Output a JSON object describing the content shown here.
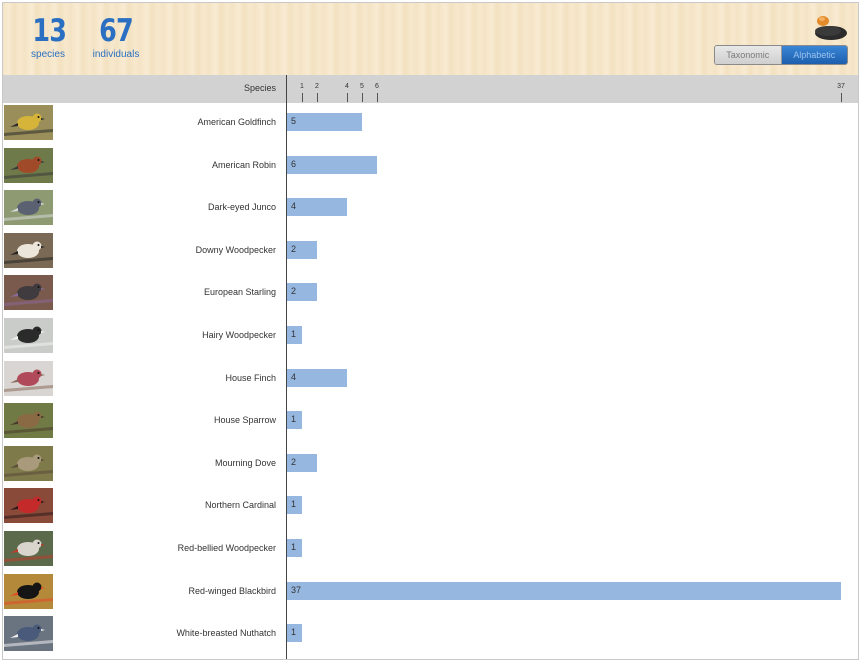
{
  "summary": {
    "species_count": "13",
    "species_label": "species",
    "individuals_count": "67",
    "individuals_label": "individuals"
  },
  "sort_toggle": {
    "taxonomic": "Taxonomic",
    "alphabetic": "Alphabetic",
    "selected": "Alphabetic"
  },
  "table": {
    "species_header": "Species"
  },
  "colors": {
    "bar": "#96b7e0",
    "accent": "#2a6fc1",
    "toggle_active": "#1d5fae"
  },
  "chart_data": {
    "type": "bar",
    "orientation": "horizontal",
    "xlim": [
      0,
      37
    ],
    "ticks": [
      "1",
      "2",
      "4",
      "5",
      "6",
      "37"
    ],
    "categories": [
      "American Goldfinch",
      "American Robin",
      "Dark-eyed Junco",
      "Downy Woodpecker",
      "European Starling",
      "Hairy Woodpecker",
      "House Finch",
      "House Sparrow",
      "Mourning Dove",
      "Northern Cardinal",
      "Red-bellied Woodpecker",
      "Red-winged Blackbird",
      "White-breasted Nuthatch"
    ],
    "values": [
      5,
      6,
      4,
      2,
      2,
      1,
      4,
      1,
      2,
      1,
      1,
      37,
      1
    ]
  },
  "thumbs": [
    {
      "bg": "#9a8f5a",
      "bird": "#d6b43a",
      "accent": "#2b2b2b"
    },
    {
      "bg": "#6f7a4a",
      "bird": "#a14a2a",
      "accent": "#3a3a3a"
    },
    {
      "bg": "#8d9a72",
      "bird": "#5a6170",
      "accent": "#d9d9d9"
    },
    {
      "bg": "#7a6a55",
      "bird": "#ece6da",
      "accent": "#222222"
    },
    {
      "bg": "#7b5a4e",
      "bird": "#3f3b3e",
      "accent": "#8a6a9a"
    },
    {
      "bg": "#c9ccc8",
      "bird": "#2b2b2b",
      "accent": "#f2f2f2"
    },
    {
      "bg": "#d8d5d2",
      "bird": "#b04a5a",
      "accent": "#8a6a5a"
    },
    {
      "bg": "#6f7a45",
      "bird": "#8a6a45",
      "accent": "#4a3a2a"
    },
    {
      "bg": "#7f7a4a",
      "bird": "#a89a7a",
      "accent": "#5a4a3a"
    },
    {
      "bg": "#8a4a3a",
      "bird": "#c42a2a",
      "accent": "#2a1a1a"
    },
    {
      "bg": "#5a6a4a",
      "bird": "#d9d4cc",
      "accent": "#c03a2a"
    },
    {
      "bg": "#b48a3a",
      "bird": "#151515",
      "accent": "#e04a2a"
    },
    {
      "bg": "#6a7480",
      "bird": "#4a5a7a",
      "accent": "#f0f0f0"
    }
  ]
}
